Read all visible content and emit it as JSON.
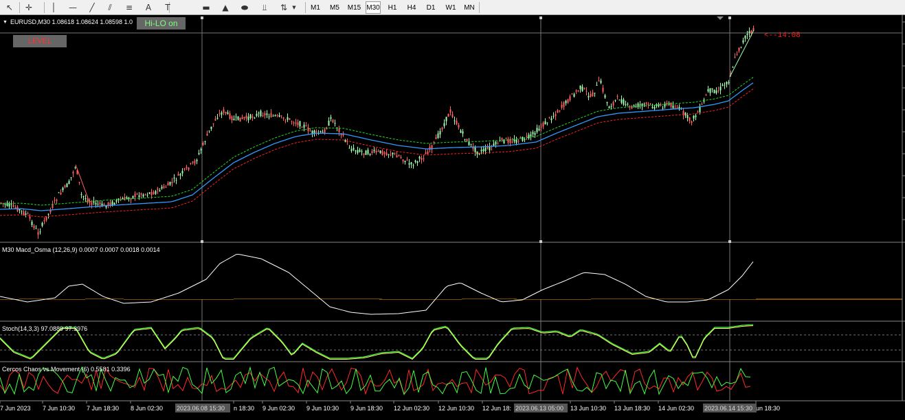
{
  "toolbar": {
    "tools": [
      {
        "icon": "cursor-arrow-icon",
        "glyph": "↖"
      },
      {
        "icon": "crosshair-icon",
        "glyph": "✛"
      },
      {
        "icon": "vertical-line-icon",
        "glyph": "│"
      },
      {
        "icon": "horizontal-line-icon",
        "glyph": "—"
      },
      {
        "icon": "trendline-icon",
        "glyph": "╱"
      },
      {
        "icon": "channel-icon",
        "glyph": "⫽"
      },
      {
        "icon": "fibonacci-icon",
        "glyph": "≡"
      },
      {
        "icon": "text-icon",
        "glyph": "A"
      },
      {
        "icon": "text-label-icon",
        "glyph": "T"
      },
      {
        "icon": "rectangle-icon",
        "glyph": "▬"
      },
      {
        "icon": "triangle-icon",
        "glyph": "▲"
      },
      {
        "icon": "ellipse-icon",
        "glyph": "⬬"
      },
      {
        "icon": "fibo-fan-icon",
        "glyph": "⫫"
      },
      {
        "icon": "arrows-icon",
        "glyph": "⇅"
      }
    ],
    "timeframes": [
      "M1",
      "M5",
      "M15",
      "M30",
      "H1",
      "H4",
      "D1",
      "W1",
      "MN"
    ],
    "active_timeframe": "M30"
  },
  "main": {
    "symbol_line": "EURUSD,M30  1.08618 1.08624 1.08598 1.0",
    "hilo_button": "Hi-LO on",
    "level_button": "LEVEL",
    "countdown": "<--14:08"
  },
  "macd": {
    "label": "M30  Macd_Osma (12,26,9) 0.0007 0.0007 0.0018 0.0014"
  },
  "stoch": {
    "label": "Stoch(14,3,3) 97.0889 97.3976"
  },
  "cercos": {
    "label": "Cercos Chaos vs Movement (6) 0.5581 0.3396"
  },
  "time_axis": {
    "labels": [
      "7 Jun 2023",
      "7 Jun 10:30",
      "7 Jun 18:30",
      "8 Jun 02:30",
      "n 18:30",
      "9 Jun 02:30",
      "9 Jun 10:30",
      "9 Jun 18:30",
      "12 Jun 02:30",
      "12 Jun 10:30",
      "12 Jun 18:",
      "13 Jun 10:30",
      "13 Jun 18:30",
      "14 Jun 02:30",
      "un 18:30"
    ],
    "highlights": [
      "2023.06.08 15:30",
      "2023.06.13 05:00",
      "2023.06.14 15:30"
    ]
  },
  "colors": {
    "candle_up": "#9fffae",
    "candle_down": "#ff6060",
    "ma_blue": "#3399ff",
    "envelope_green": "#22dd22",
    "envelope_red": "#ff2222",
    "macd_green": "#008800",
    "macd_cyan": "#00ffff",
    "macd_red": "#ff0000",
    "macd_yellow": "#ffff00",
    "stoch_green": "#44ff44",
    "stoch_yellow": "#ffff66",
    "hilo_text": "#7dff7d",
    "level_text": "#ff3333",
    "countdown": "#ff2222"
  }
}
